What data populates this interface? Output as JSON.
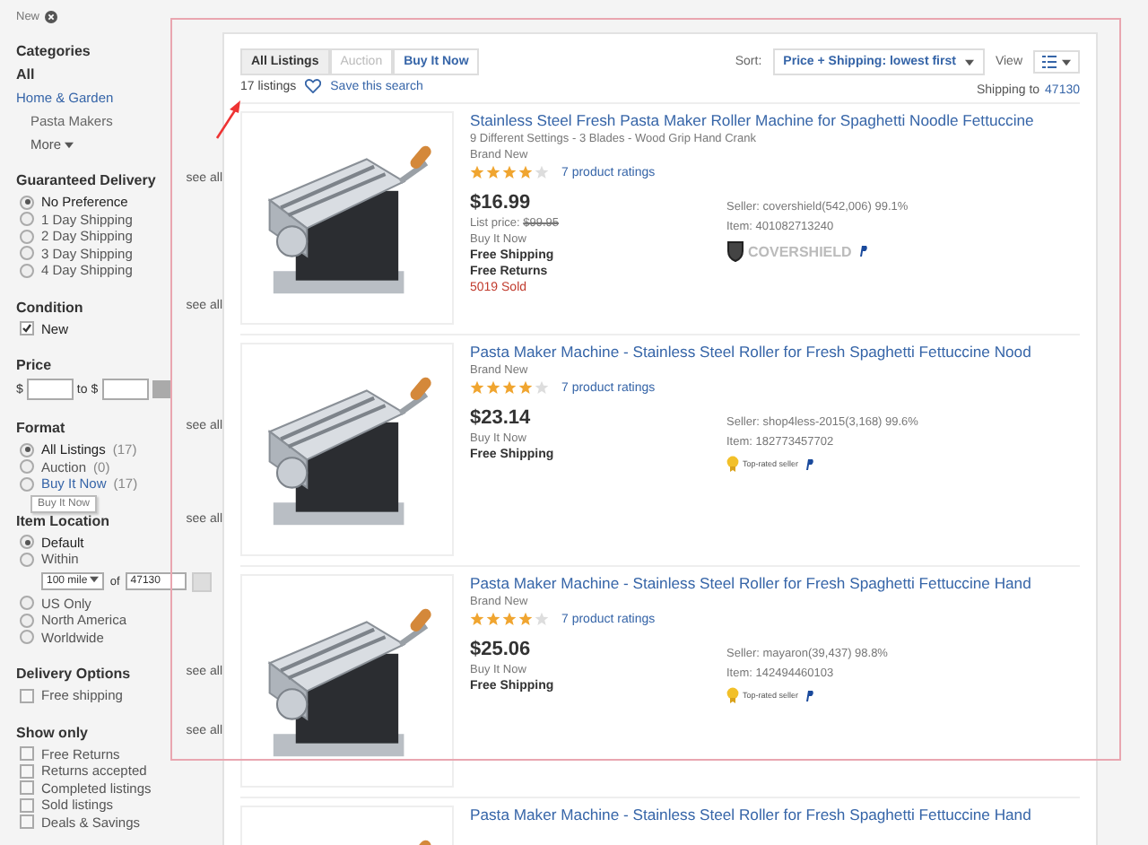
{
  "sidebar": {
    "chip": "New",
    "categories": {
      "title": "Categories",
      "all": "All",
      "parent": "Home & Garden",
      "child": "Pasta Makers",
      "more": "More"
    },
    "sections": [
      {
        "kind": "radio",
        "title": "Guaranteed Delivery",
        "see_all": "see all",
        "options": [
          {
            "label": "No Preference",
            "selected": true
          },
          {
            "label": "1 Day Shipping",
            "selected": false
          },
          {
            "label": "2 Day Shipping",
            "selected": false
          },
          {
            "label": "3 Day Shipping",
            "selected": false
          },
          {
            "label": "4 Day Shipping",
            "selected": false
          }
        ]
      },
      {
        "kind": "checkbox",
        "title": "Condition",
        "see_all": "see all",
        "options": [
          {
            "label": "New",
            "checked": true
          }
        ]
      },
      {
        "kind": "price",
        "title": "Price",
        "currency": "$",
        "to": "to $"
      },
      {
        "kind": "radio",
        "title": "Format",
        "see_all": "see all",
        "options": [
          {
            "label": "All Listings",
            "count": "(17)",
            "selected": true,
            "link": false
          },
          {
            "label": "Auction",
            "count": "(0)",
            "selected": false,
            "link": false
          },
          {
            "label": "Buy It Now",
            "count": "(17)",
            "selected": false,
            "link": true,
            "tooltip": "Buy It Now"
          }
        ]
      },
      {
        "kind": "radio",
        "title": "Item Location",
        "see_all": "see all",
        "options": [
          {
            "label": "Default",
            "selected": true
          },
          {
            "label": "Within",
            "selected": false,
            "distance": {
              "value": "100 mile",
              "of": "of",
              "zip": "47130"
            }
          },
          {
            "label": "US Only",
            "selected": false
          },
          {
            "label": "North America",
            "selected": false
          },
          {
            "label": "Worldwide",
            "selected": false
          }
        ]
      },
      {
        "kind": "checkbox",
        "title": "Delivery Options",
        "see_all": "see all",
        "options": [
          {
            "label": "Free shipping",
            "checked": false
          }
        ]
      },
      {
        "kind": "checkbox",
        "title": "Show only",
        "see_all": "see all",
        "options": [
          {
            "label": "Free Returns",
            "checked": false
          },
          {
            "label": "Returns accepted",
            "checked": false
          },
          {
            "label": "Completed listings",
            "checked": false
          },
          {
            "label": "Sold listings",
            "checked": false
          },
          {
            "label": "Deals & Savings",
            "checked": false
          }
        ]
      }
    ]
  },
  "toolbar": {
    "tabs": [
      {
        "label": "All Listings",
        "selected": true,
        "disabled": false
      },
      {
        "label": "Auction",
        "selected": false,
        "disabled": true
      },
      {
        "label": "Buy It Now",
        "selected": false,
        "disabled": false
      }
    ],
    "sort_label": "Sort:",
    "sort_value": "Price + Shipping: lowest first",
    "view_label": "View",
    "count": "17 listings",
    "save_search": "Save this search",
    "shipping_to": "Shipping to",
    "zip": "47130"
  },
  "listings": [
    {
      "title": "Stainless Steel Fresh Pasta Maker Roller Machine for Spaghetti Noodle Fettuccine",
      "subtitle": "9 Different Settings - 3 Blades - Wood Grip Hand Crank",
      "condition": "Brand New",
      "stars": 4,
      "ratings": "7 product ratings",
      "price": "$16.99",
      "list_price_label": "List price:",
      "list_price": "$99.95",
      "format": "Buy It Now",
      "shipping": "Free Shipping",
      "returns": "Free Returns",
      "sold": "5019 Sold",
      "seller": "Seller: covershield(542,006) 99.1%",
      "item": "Item: 401082713240",
      "badge": {
        "kind": "store-logo",
        "text": "COVERSHIELD"
      }
    },
    {
      "title": "Pasta Maker Machine - Stainless Steel Roller for Fresh Spaghetti Fettuccine Nood",
      "condition": "Brand New",
      "stars": 4,
      "ratings": "7 product ratings",
      "price": "$23.14",
      "format": "Buy It Now",
      "shipping": "Free Shipping",
      "seller": "Seller: shop4less-2015(3,168) 99.6%",
      "item": "Item: 182773457702",
      "badge": {
        "kind": "top-rated",
        "text": "Top-rated seller"
      }
    },
    {
      "title": "Pasta Maker Machine - Stainless Steel Roller for Fresh Spaghetti Fettuccine Hand",
      "condition": "Brand New",
      "stars": 4,
      "ratings": "7 product ratings",
      "price": "$25.06",
      "format": "Buy It Now",
      "shipping": "Free Shipping",
      "seller": "Seller: mayaron(39,437) 98.8%",
      "item": "Item: 142494460103",
      "badge": {
        "kind": "top-rated",
        "text": "Top-rated seller"
      }
    },
    {
      "title": "Pasta Maker Machine - Stainless Steel Roller for Fresh Spaghetti Fettuccine Hand"
    }
  ]
}
